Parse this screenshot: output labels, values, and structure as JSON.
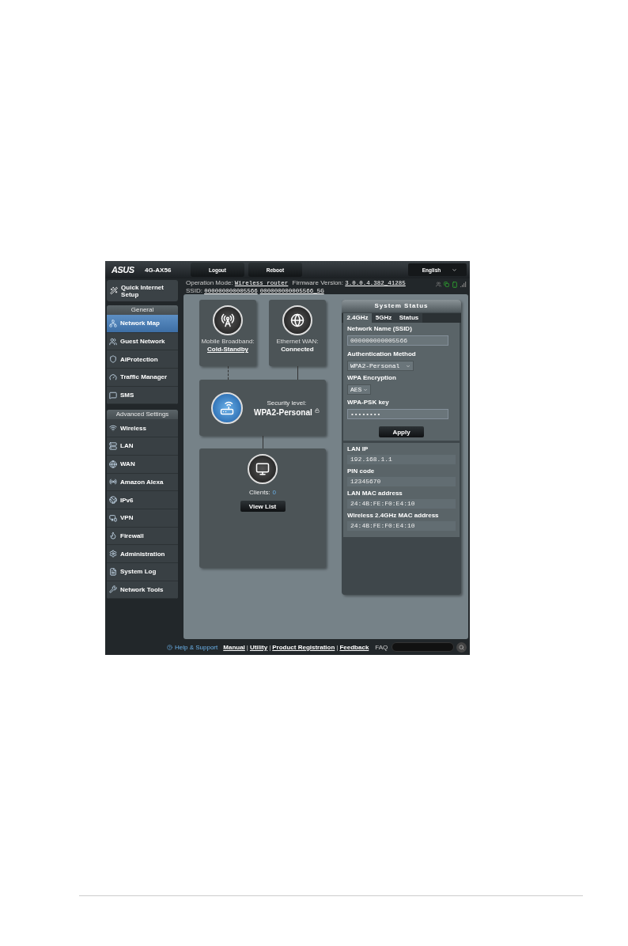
{
  "header": {
    "brand": "ASUS",
    "model": "4G-AX56",
    "buttons": [
      "Logout",
      "Reboot"
    ],
    "language": "English"
  },
  "info": {
    "mode_label": "Operation Mode:",
    "mode_value": "Wireless router",
    "firmware_label": "Firmware Version:",
    "firmware_value": "3.0.0.4.382_41285",
    "ssid_label": "SSID:",
    "ssids": [
      "000000000005566",
      "000000000005566_5G"
    ]
  },
  "sidebar": {
    "quick_setup": "Quick Internet Setup",
    "sections": [
      {
        "title": "General",
        "items": [
          {
            "label": "Network Map",
            "selected": true
          },
          {
            "label": "Guest Network",
            "selected": false
          },
          {
            "label": "AiProtection",
            "selected": false
          },
          {
            "label": "Traffic Manager",
            "selected": false
          },
          {
            "label": "SMS",
            "selected": false
          }
        ]
      },
      {
        "title": "Advanced Settings",
        "items": [
          {
            "label": "Wireless",
            "selected": false
          },
          {
            "label": "LAN",
            "selected": false
          },
          {
            "label": "WAN",
            "selected": false
          },
          {
            "label": "Amazon Alexa",
            "selected": false
          },
          {
            "label": "IPv6",
            "selected": false
          },
          {
            "label": "VPN",
            "selected": false
          },
          {
            "label": "Firewall",
            "selected": false
          },
          {
            "label": "Administration",
            "selected": false
          },
          {
            "label": "System Log",
            "selected": false
          },
          {
            "label": "Network Tools",
            "selected": false
          }
        ]
      }
    ]
  },
  "network_map": {
    "mobile_broadband": {
      "label": "Mobile Broadband:",
      "status": "Cold-Standby"
    },
    "ethernet_wan": {
      "label": "Ethernet WAN:",
      "status": "Connected"
    },
    "security": {
      "label": "Security level:",
      "value": "WPA2-Personal"
    },
    "clients": {
      "label": "Clients:",
      "count": "0",
      "button": "View List"
    }
  },
  "system_status": {
    "title": "System Status",
    "tabs": [
      {
        "label": "2.4GHz",
        "selected": true
      },
      {
        "label": "5GHz",
        "selected": false
      },
      {
        "label": "Status",
        "selected": false
      }
    ],
    "ssid": {
      "label": "Network Name (SSID)",
      "value": "000000000005566"
    },
    "auth": {
      "label": "Authentication Method",
      "value": "WPA2-Personal"
    },
    "encryption": {
      "label": "WPA Encryption",
      "value": "AES"
    },
    "psk": {
      "label": "WPA-PSK key",
      "value": "••••••••"
    },
    "apply": "Apply",
    "details": [
      {
        "label": "LAN IP",
        "value": "192.168.1.1"
      },
      {
        "label": "PIN code",
        "value": "12345670"
      },
      {
        "label": "LAN MAC address",
        "value": "24:4B:FE:F0:E4:10"
      },
      {
        "label": "Wireless 2.4GHz MAC address",
        "value": "24:4B:FE:F0:E4:10"
      }
    ]
  },
  "footer": {
    "help": "Help & Support",
    "links": [
      "Manual",
      "Utility",
      "Product Registration",
      "Feedback"
    ],
    "separator": "|",
    "faq": "FAQ"
  }
}
